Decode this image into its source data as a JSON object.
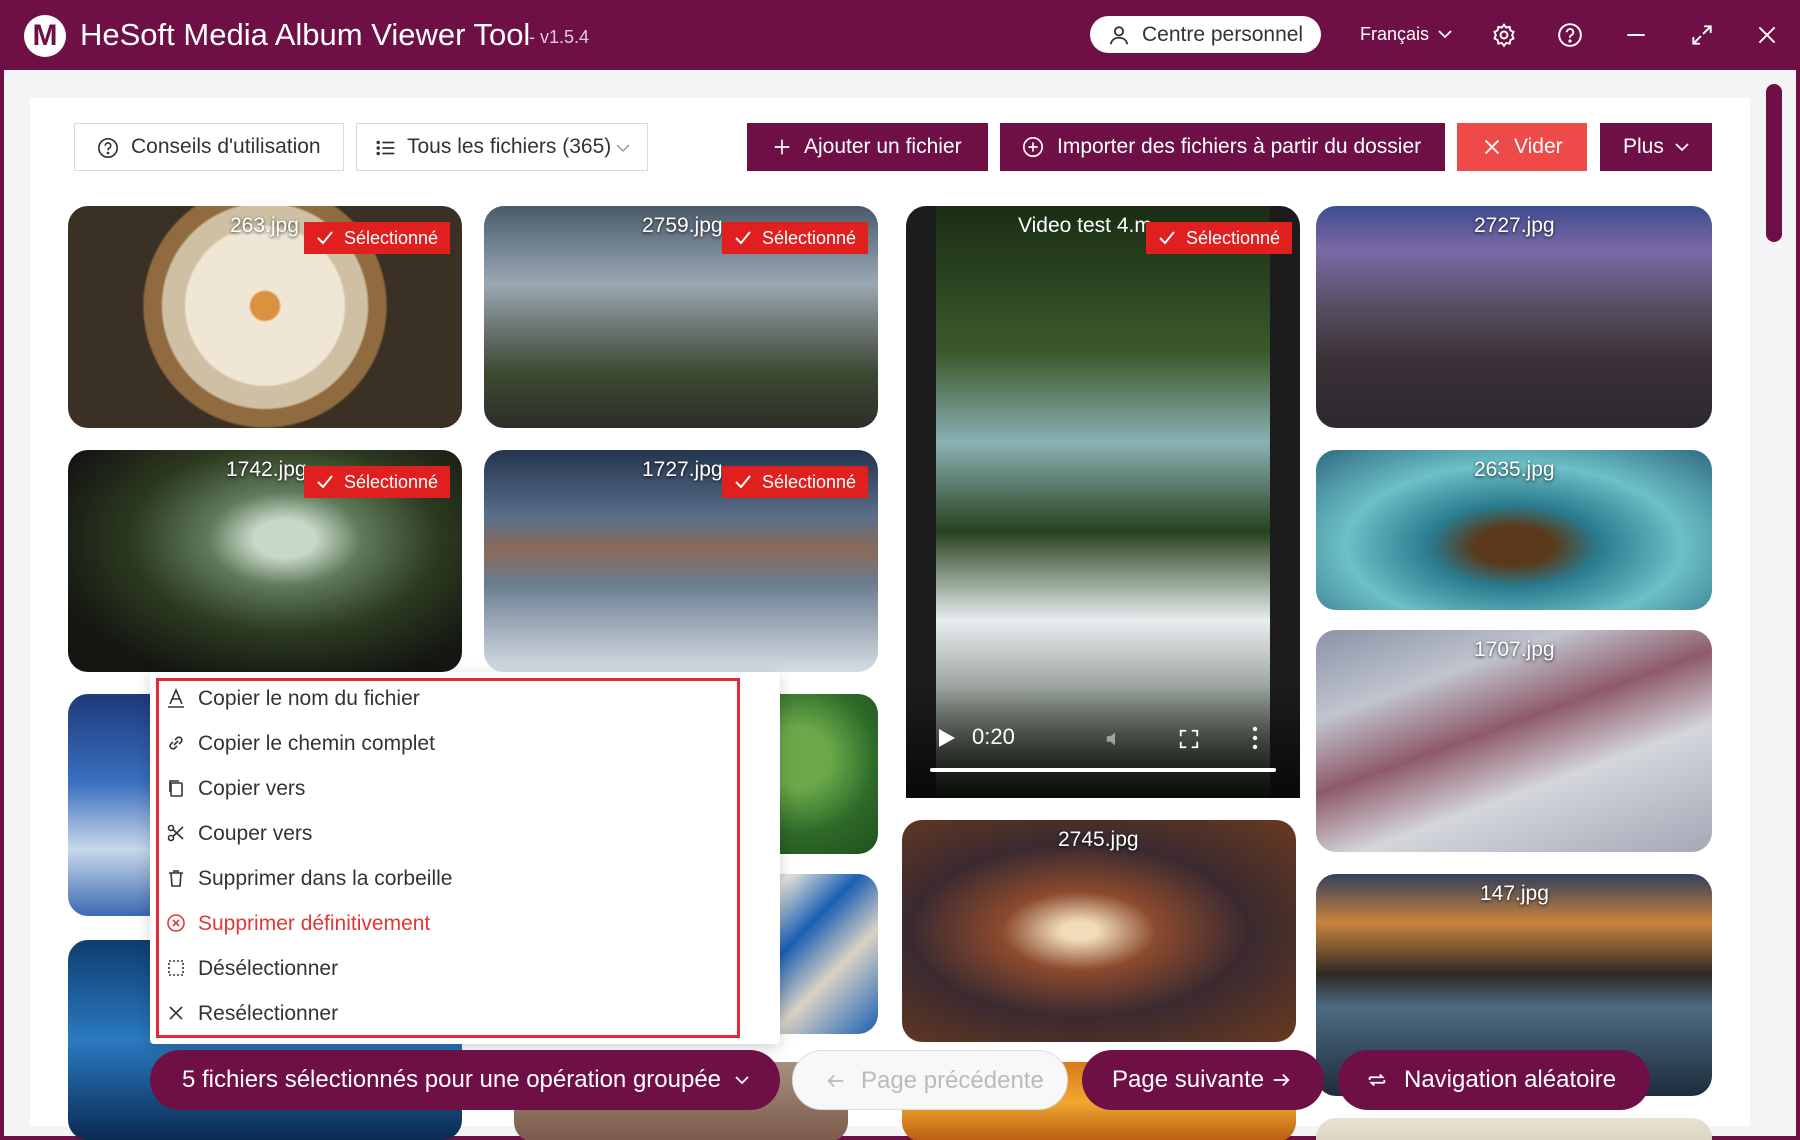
{
  "app": {
    "logo_letter": "M",
    "title": "HeSoft Media Album Viewer Tool",
    "version": "- v1.5.4",
    "personal_center": "Centre personnel",
    "language": "Français",
    "icons": [
      "user-icon",
      "chevron-down-icon",
      "gear-icon",
      "help-icon",
      "minimize-icon",
      "maximize-icon",
      "close-icon"
    ]
  },
  "toolbar": {
    "tips_label": "Conseils d'utilisation",
    "filter_label": "Tous les fichiers (365)",
    "add_file_label": "Ajouter un fichier",
    "import_folder_label": "Importer des fichiers à partir du dossier",
    "clear_label": "Vider",
    "more_label": "Plus"
  },
  "colors": {
    "brand": "#6e1046",
    "selected_badge": "#e0201f",
    "danger": "#e03838",
    "clear_button": "#ef4a4a"
  },
  "gallery": {
    "selected_label": "Sélectionné",
    "tiles": [
      {
        "name": "263.jpg",
        "selected": true
      },
      {
        "name": "2759.jpg",
        "selected": true
      },
      {
        "name": "Video test 4.m",
        "selected": true,
        "type": "video"
      },
      {
        "name": "2727.jpg",
        "selected": false
      },
      {
        "name": "1742.jpg",
        "selected": true
      },
      {
        "name": "1727.jpg",
        "selected": true
      },
      {
        "name": "2635.jpg",
        "selected": false
      },
      {
        "name": "1707.jpg",
        "selected": false
      },
      {
        "name": "2745.jpg",
        "selected": false
      },
      {
        "name": "147.jpg",
        "selected": false
      }
    ],
    "video": {
      "time": "0:20"
    }
  },
  "context_menu": {
    "items": [
      {
        "label": "Copier le nom du fichier",
        "icon": "text-a-icon"
      },
      {
        "label": "Copier le chemin complet",
        "icon": "link-icon"
      },
      {
        "label": "Copier vers",
        "icon": "copy-icon"
      },
      {
        "label": "Couper vers",
        "icon": "scissors-icon"
      },
      {
        "label": "Supprimer dans la corbeille",
        "icon": "trash-icon"
      },
      {
        "label": "Supprimer définitivement",
        "icon": "circle-x-icon",
        "danger": true
      },
      {
        "label": "Désélectionner",
        "icon": "deselect-icon"
      },
      {
        "label": "Resélectionner",
        "icon": "x-icon"
      }
    ]
  },
  "bottom_bar": {
    "batch_label": "5 fichiers sélectionnés pour une opération groupée",
    "prev_label": "Page précédente",
    "next_label": "Page suivante",
    "random_label": "Navigation aléatoire"
  }
}
